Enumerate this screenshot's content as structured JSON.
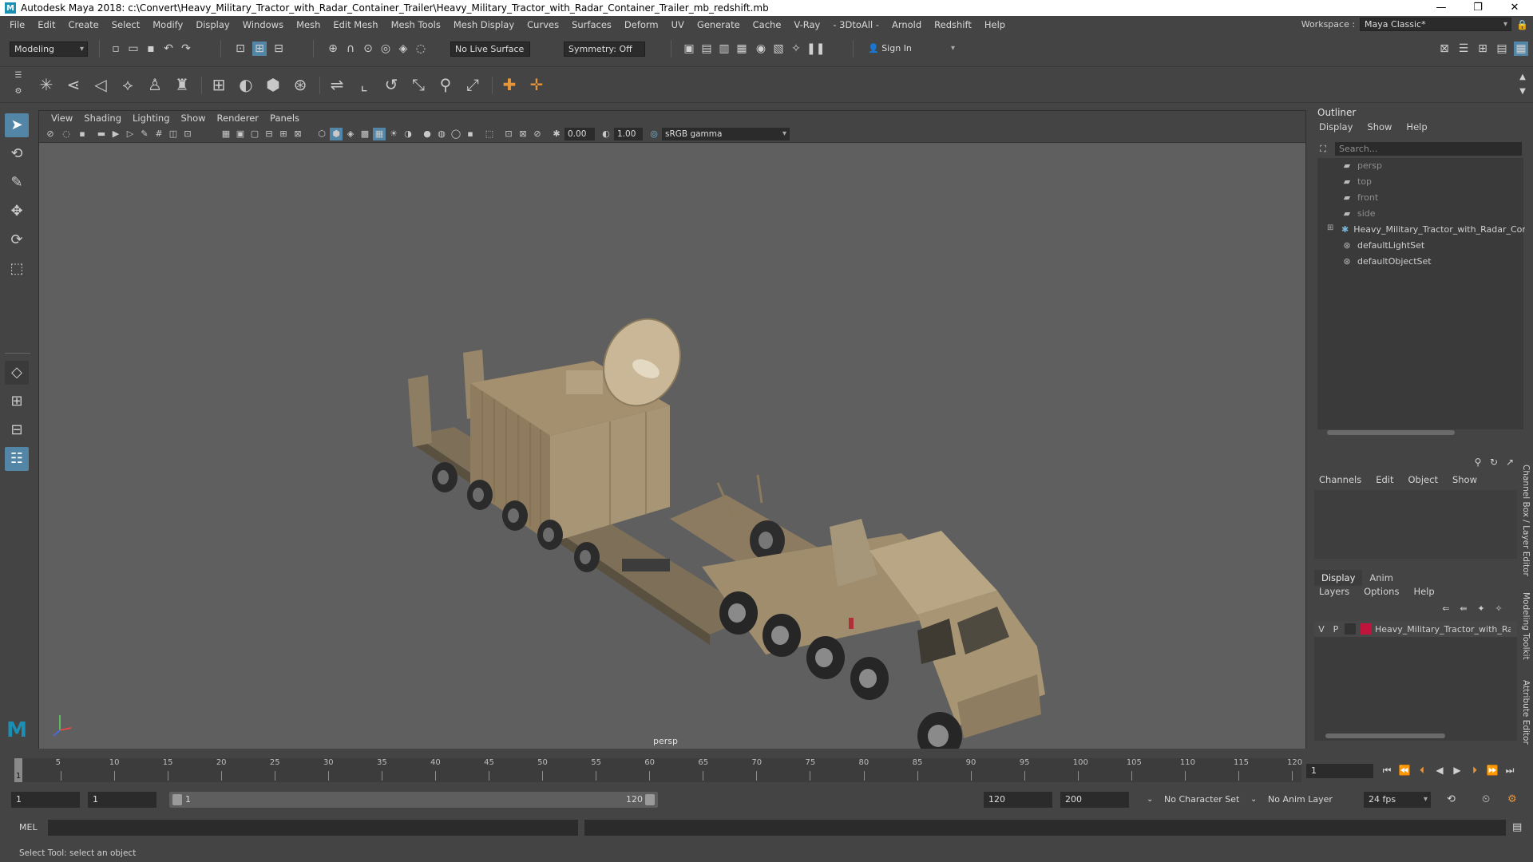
{
  "title_bar": {
    "app_letter": "M",
    "title": "Autodesk Maya 2018: c:\\Convert\\Heavy_Military_Tractor_with_Radar_Container_Trailer\\Heavy_Military_Tractor_with_Radar_Container_Trailer_mb_redshift.mb",
    "minimize": "—",
    "maximize": "❐",
    "close": "✕"
  },
  "menubar": {
    "items": [
      "File",
      "Edit",
      "Create",
      "Select",
      "Modify",
      "Display",
      "Windows",
      "Mesh",
      "Edit Mesh",
      "Mesh Tools",
      "Mesh Display",
      "Curves",
      "Surfaces",
      "Deform",
      "UV",
      "Generate",
      "Cache",
      "V-Ray",
      "- 3DtoAll -",
      "Arnold",
      "Redshift",
      "Help"
    ],
    "workspace_label": "Workspace :",
    "workspace_value": "Maya Classic*"
  },
  "statusline": {
    "mode": "Modeling",
    "live_surface": "No Live Surface",
    "symmetry": "Symmetry: Off",
    "sign_in": "Sign In"
  },
  "viewport": {
    "menu": [
      "View",
      "Shading",
      "Lighting",
      "Show",
      "Renderer",
      "Panels"
    ],
    "exposure": "0.00",
    "gamma": "1.00",
    "color_space": "sRGB gamma",
    "camera": "persp"
  },
  "outliner": {
    "title": "Outliner",
    "menu": [
      "Display",
      "Show",
      "Help"
    ],
    "search_placeholder": "Search...",
    "items": [
      {
        "label": "persp",
        "icon": "camera-icon",
        "dim": true
      },
      {
        "label": "top",
        "icon": "camera-icon",
        "dim": true
      },
      {
        "label": "front",
        "icon": "camera-icon",
        "dim": true
      },
      {
        "label": "side",
        "icon": "camera-icon",
        "dim": true
      },
      {
        "label": "Heavy_Military_Tractor_with_Radar_Cont",
        "icon": "group-icon",
        "dim": false
      },
      {
        "label": "defaultLightSet",
        "icon": "set-icon",
        "dim": false
      },
      {
        "label": "defaultObjectSet",
        "icon": "set-icon",
        "dim": false
      }
    ]
  },
  "channel_box": {
    "menu": [
      "Channels",
      "Edit",
      "Object",
      "Show"
    ]
  },
  "layer_editor": {
    "tabs": [
      "Display",
      "Anim"
    ],
    "menu": [
      "Layers",
      "Options",
      "Help"
    ],
    "layer": {
      "v": "V",
      "p": "P",
      "name": "Heavy_Military_Tractor_with_Rad",
      "color": "#c0143c"
    }
  },
  "side_tabs": [
    "Channel Box / Layer Editor",
    "Modeling Toolkit",
    "Attribute Editor"
  ],
  "timeline": {
    "ticks": [
      "5",
      "10",
      "15",
      "20",
      "25",
      "30",
      "35",
      "40",
      "45",
      "50",
      "55",
      "60",
      "65",
      "70",
      "75",
      "80",
      "85",
      "90",
      "95",
      "100",
      "105",
      "110",
      "115",
      "120"
    ],
    "current_marker": "1",
    "current_frame": "1"
  },
  "range": {
    "start": "1",
    "playback_start": "1",
    "slider_start": "1",
    "slider_end": "120",
    "playback_end": "120",
    "end": "200",
    "character_set": "No Character Set",
    "anim_layer": "No Anim Layer",
    "fps": "24 fps"
  },
  "command": {
    "label": "MEL"
  },
  "help_line": "Select Tool: select an object",
  "colors": {
    "accent": "#5285a6",
    "maya_logo": "#1b8fb4",
    "layer_color": "#c0143c"
  }
}
